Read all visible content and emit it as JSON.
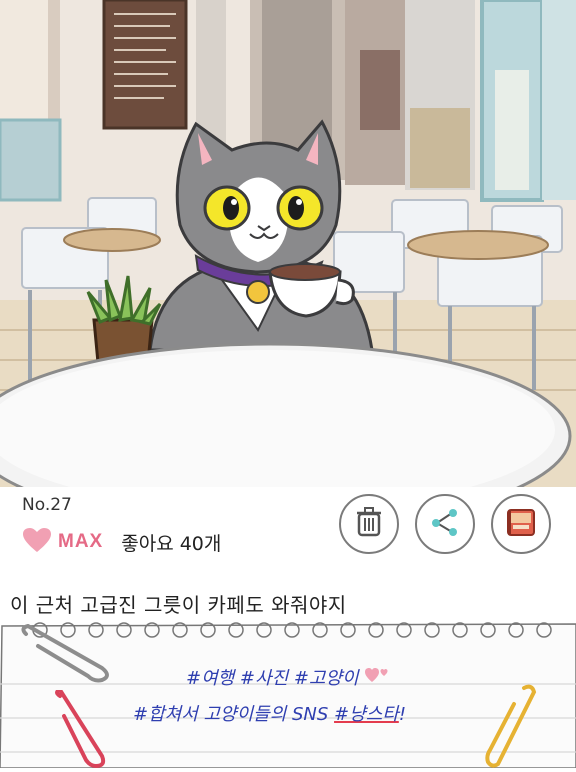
{
  "post": {
    "number": "No.27",
    "like_badge": "MAX",
    "like_text": "좋아요 40개",
    "caption": "이 근처 고급진 그릇이 카페도 와줘야지",
    "hashtags_line1": "#여행 #사진 #고양이",
    "hashtags_line2_prefix": "#합쳐서 고양이들의 SNS ",
    "hashtags_line2_emphasis": "#냥스타",
    "hashtags_line2_suffix": "!"
  },
  "actions": {
    "delete_icon": "trash-icon",
    "share_icon": "share-icon",
    "album_icon": "album-book-icon"
  },
  "colors": {
    "heart": "#f1a0b3",
    "max_text": "#e56a86",
    "hashtag_blue": "#2f3fb0",
    "underline_red": "#e43c4e",
    "cat_gray": "#8a8a8c",
    "collar_purple": "#6a3d9a"
  }
}
